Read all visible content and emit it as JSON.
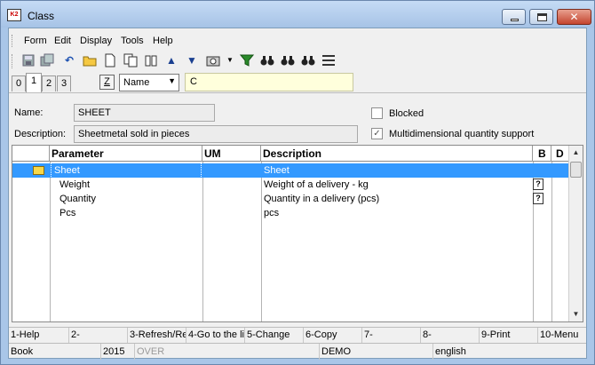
{
  "window": {
    "title": "Class",
    "app_badge": "K2"
  },
  "menu": [
    "Form",
    "Edit",
    "Display",
    "Tools",
    "Help"
  ],
  "tabs": {
    "items": [
      "0",
      "1",
      "2",
      "3"
    ],
    "active": "1"
  },
  "filter": {
    "z_label": "Z",
    "field": "Name",
    "value": "C"
  },
  "form": {
    "name_label": "Name:",
    "name_value": "SHEET",
    "description_label": "Description:",
    "description_value": "Sheetmetal sold in pieces",
    "blocked_label": "Blocked",
    "blocked_checked": false,
    "multidim_label": "Multidimensional quantity support",
    "multidim_checked": true
  },
  "grid": {
    "columns": [
      "Parameter",
      "UM",
      "Description",
      "B",
      "D"
    ],
    "rows": [
      {
        "parameter": "Sheet",
        "um": "",
        "description": "Sheet",
        "selected": true,
        "folder": true,
        "b_icon": false
      },
      {
        "parameter": "Weight",
        "um": "",
        "description": "Weight of a delivery - kg",
        "selected": false,
        "folder": false,
        "b_icon": true
      },
      {
        "parameter": "Quantity",
        "um": "",
        "description": "Quantity in a delivery (pcs)",
        "selected": false,
        "folder": false,
        "b_icon": true
      },
      {
        "parameter": "Pcs",
        "um": "",
        "description": "pcs",
        "selected": false,
        "folder": false,
        "b_icon": false
      }
    ]
  },
  "function_keys": [
    "1-Help",
    "2-",
    "3-Refresh/Re",
    "4-Go to the li",
    "5-Change",
    "6-Copy",
    "7-",
    "8-",
    "9-Print",
    "10-Menu"
  ],
  "status": [
    "Book",
    "2015",
    "OVER",
    "DEMO",
    "english"
  ],
  "icons": {
    "toolbar": [
      "save-icon",
      "save-all-icon",
      "undo-icon",
      "open-folder-icon",
      "new-document-icon",
      "copy-document-icon",
      "book-icon",
      "arrow-up-icon",
      "arrow-down-icon",
      "camera-icon",
      "dropdown-arrow-icon",
      "filter-icon",
      "binoculars-icon",
      "binoculars-next-icon",
      "binoculars-find-icon",
      "list-icon"
    ]
  }
}
